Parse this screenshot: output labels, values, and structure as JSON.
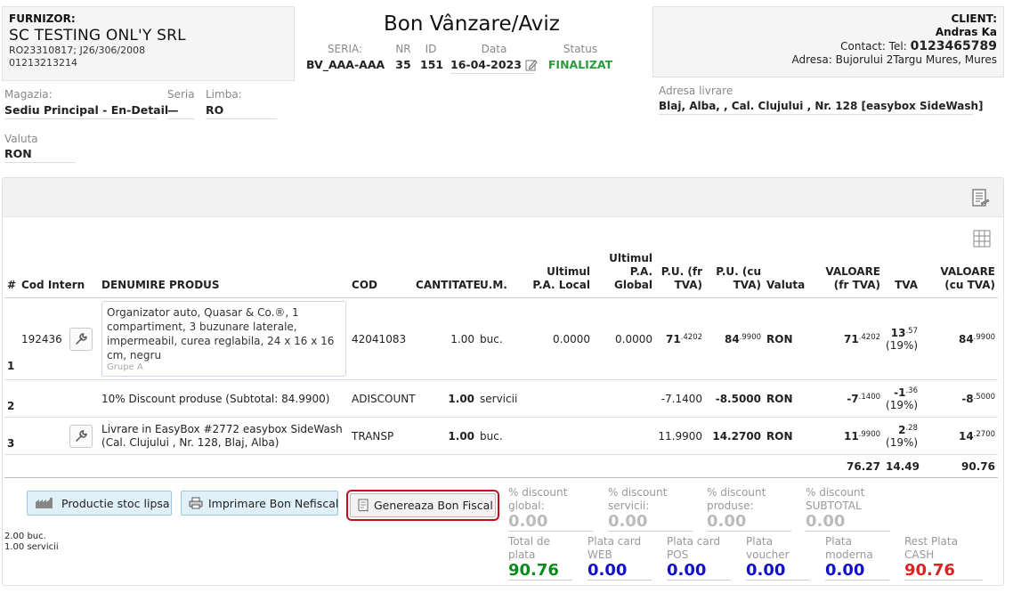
{
  "supplier": {
    "heading": "FURNIZOR:",
    "name": "SC TESTING ONL'Y SRL",
    "line1": "RO23310817; J26/306/2008",
    "line2": "01213213214"
  },
  "document": {
    "title": "Bon Vânzare/Aviz",
    "seria_label": "SERIA:",
    "seria": "BV_AAA-AAA",
    "nr_label": "NR",
    "nr": "35",
    "id_label": "ID",
    "id": "151",
    "data_label": "Data",
    "data": "16-04-2023",
    "status_label": "Status",
    "status": "FINALIZAT"
  },
  "client": {
    "heading": "CLIENT:",
    "name": "Andras Ka",
    "contact_prefix": "Contact: Tel:",
    "phone": "0123465789",
    "address_prefix": "Adresa:",
    "address": "Bujorului 2Targu Mures, Mures"
  },
  "settings": {
    "magazia_label": "Magazia:",
    "magazia": "Sediu Principal - En-Detail",
    "seria_label": "Seria",
    "seria": "—",
    "limba_label": "Limba:",
    "limba": "RO",
    "valuta_label": "Valuta",
    "valuta": "RON",
    "adresa_livrare_label": "Adresa livrare",
    "adresa_livrare": "Blaj, Alba, , Cal. Clujului , Nr. 128 [easybox SideWash]"
  },
  "table": {
    "headers": {
      "nr": "#",
      "cod_intern": "Cod Intern",
      "denumire": "DENUMIRE PRODUS",
      "cod": "COD",
      "cantitate": "CANTITATE",
      "um": "U.M.",
      "ultimul_local": "Ultimul P.A. Local",
      "ultimul_global": "Ultimul P.A. Global",
      "pu_fara": "P.U. (fr TVA)",
      "pu_cu": "P.U. (cu TVA)",
      "valuta": "Valuta",
      "valoare_fara": "VALOARE (fr TVA)",
      "tva": "TVA",
      "valoare_cu": "VALOARE (cu TVA)"
    },
    "rows": [
      {
        "nr": "1",
        "cod_intern": "192436",
        "denumire": "Organizator auto, Quasar & Co.®, 1 compartiment, 3 buzunare laterale, impermeabil, curea reglabila, 24 x 16 x 16 cm, negru",
        "grupa": "Grupe A",
        "cod": "42041083",
        "cantitate": "1.00",
        "um": "buc.",
        "ultimul_local": "0.0000",
        "ultimul_global": "0.0000",
        "pu_fara_int": "71",
        "pu_fara_dec": ".4202",
        "pu_cu_int": "84",
        "pu_cu_dec": ".9900",
        "valuta": "RON",
        "valoare_fara_int": "71",
        "valoare_fara_dec": ".4202",
        "tva_int": "13",
        "tva_dec": ".57",
        "tva_pct": "(19%)",
        "valoare_cu_int": "84",
        "valoare_cu_dec": ".9900"
      },
      {
        "nr": "2",
        "cod_intern": "",
        "denumire": "10% Discount produse (Subtotal: 84.9900)",
        "grupa": "",
        "cod": "ADISCOUNT",
        "cantitate": "1.00",
        "um": "servicii",
        "ultimul_local": "",
        "ultimul_global": "",
        "pu_fara": "-7.1400",
        "pu_cu": "-8.5000",
        "valuta": "RON",
        "valoare_fara_int": "-7",
        "valoare_fara_dec": ".1400",
        "tva_int": "-1",
        "tva_dec": ".36",
        "tva_pct": "(19%)",
        "valoare_cu_int": "-8",
        "valoare_cu_dec": ".5000"
      },
      {
        "nr": "3",
        "cod_intern": "",
        "denumire": "Livrare in EasyBox #2772 easybox SideWash (Cal. Clujului , Nr. 128, Blaj, Alba)",
        "grupa": "",
        "cod": "TRANSP",
        "cantitate": "1.00",
        "um": "buc.",
        "ultimul_local": "",
        "ultimul_global": "",
        "pu_fara": "11.9900",
        "pu_cu": "14.2700",
        "valuta": "RON",
        "valoare_fara_int": "11",
        "valoare_fara_dec": ".9900",
        "tva_int": "2",
        "tva_dec": ".28",
        "tva_pct": "(19%)",
        "valoare_cu_int": "14",
        "valoare_cu_dec": ".2700"
      }
    ],
    "totals": {
      "valoare_fara": "76.27",
      "tva": "14.49",
      "valoare_cu": "90.76"
    }
  },
  "buttons": {
    "productie": "Productie stoc lipsa",
    "imprimare": "Imprimare Bon Nefiscal",
    "genereaza": "Genereaza Bon Fiscal"
  },
  "summary": {
    "qty_buc": "2.00 buc.",
    "qty_servicii": "1.00 servicii"
  },
  "discounts": {
    "global_label": "% discount global:",
    "global": "0.00",
    "servicii_label": "% discount servicii:",
    "servicii": "0.00",
    "produse_label": "% discount produse:",
    "produse": "0.00",
    "subtotal_label": "% discount SUBTOTAL",
    "subtotal": "0.00"
  },
  "payments": {
    "total_label": "Total de plata",
    "total": "90.76",
    "web_label": "Plata card WEB",
    "web": "0.00",
    "pos_label": "Plata card POS",
    "pos": "0.00",
    "voucher_label": "Plata voucher",
    "voucher": "0.00",
    "moderna_label": "Plata moderna",
    "moderna": "0.00",
    "rest_label": "Rest Plata CASH",
    "rest": "90.76"
  },
  "colors": {
    "status": "#2a9a3a",
    "total": "#0a8a1e",
    "payment": "#1111cc",
    "rest": "#dd2222",
    "highlight": "#c0101a"
  }
}
